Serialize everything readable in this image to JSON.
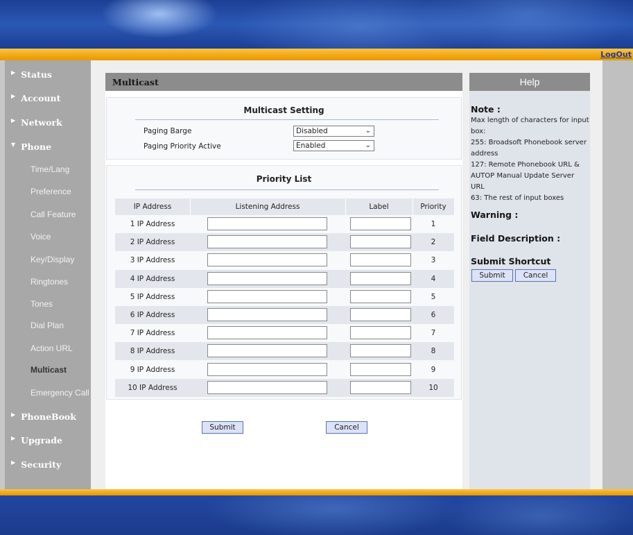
{
  "header": {
    "logout_label": "LogOut"
  },
  "nav": {
    "status": "Status",
    "account": "Account",
    "network": "Network",
    "phone": "Phone",
    "phone_items": [
      "Time/Lang",
      "Preference",
      "Call Feature",
      "Voice",
      "Key/Display",
      "Ringtones",
      "Tones",
      "Dial Plan",
      "Action URL",
      "Multicast",
      "Emergency Call"
    ],
    "active_item": "Multicast",
    "phonebook": "PhoneBook",
    "upgrade": "Upgrade",
    "security": "Security"
  },
  "page": {
    "title": "Multicast",
    "setting_section": {
      "title": "Multicast Setting",
      "paging_barge_label": "Paging Barge",
      "paging_barge_value": "Disabled",
      "paging_priority_label": "Paging Priority Active",
      "paging_priority_value": "Enabled"
    },
    "priority_section": {
      "title": "Priority List",
      "columns": [
        "IP Address",
        "Listening Address",
        "Label",
        "Priority"
      ],
      "rows": [
        {
          "name": "1 IP Address",
          "address": "",
          "label": "",
          "priority": "1"
        },
        {
          "name": "2 IP Address",
          "address": "",
          "label": "",
          "priority": "2"
        },
        {
          "name": "3 IP Address",
          "address": "",
          "label": "",
          "priority": "3"
        },
        {
          "name": "4 IP Address",
          "address": "",
          "label": "",
          "priority": "4"
        },
        {
          "name": "5 IP Address",
          "address": "",
          "label": "",
          "priority": "5"
        },
        {
          "name": "6 IP Address",
          "address": "",
          "label": "",
          "priority": "6"
        },
        {
          "name": "7 IP Address",
          "address": "",
          "label": "",
          "priority": "7"
        },
        {
          "name": "8 IP Address",
          "address": "",
          "label": "",
          "priority": "8"
        },
        {
          "name": "9 IP Address",
          "address": "",
          "label": "",
          "priority": "9"
        },
        {
          "name": "10 IP Address",
          "address": "",
          "label": "",
          "priority": "10"
        }
      ]
    },
    "submit_label": "Submit",
    "cancel_label": "Cancel"
  },
  "help": {
    "title": "Help",
    "note_heading": "Note :",
    "note_lines": [
      "Max length of characters for input box:",
      "255: Broadsoft Phonebook server address",
      "127: Remote Phonebook URL & AUTOP Manual Update Server URL",
      "63: The rest of input boxes"
    ],
    "warning_heading": "Warning :",
    "field_heading": "Field Description :",
    "shortcut_heading": "Submit Shortcut",
    "submit_label": "Submit",
    "cancel_label": "Cancel"
  },
  "colors": {
    "accent_gold": "#f4a611",
    "banner_blue": "#1c3f95",
    "header_gray": "#8c8c8c"
  }
}
